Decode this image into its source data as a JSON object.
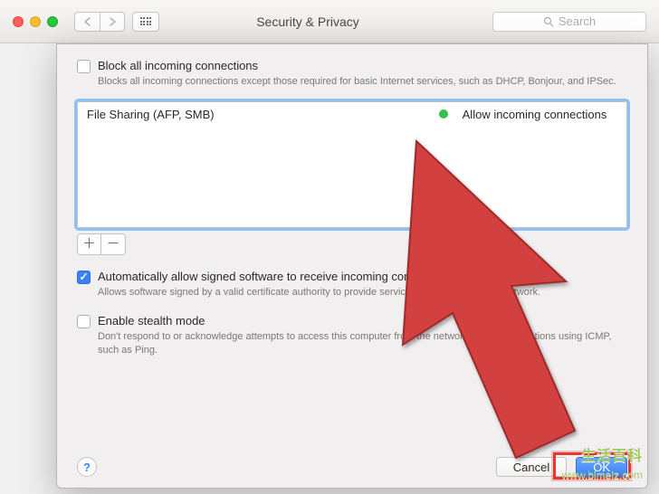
{
  "header": {
    "title": "Security & Privacy",
    "search_placeholder": "Search"
  },
  "block_all": {
    "checked": false,
    "label": "Block all incoming connections",
    "description": "Blocks all incoming connections except those required for basic Internet services, such as DHCP, Bonjour, and IPSec."
  },
  "list": {
    "items": [
      {
        "name": "File Sharing (AFP, SMB)",
        "status": "Allow incoming connections"
      }
    ]
  },
  "auto_allow": {
    "checked": true,
    "label": "Automatically allow signed software to receive incoming connections",
    "description": "Allows software signed by a valid certificate authority to provide services accessed from the network."
  },
  "stealth": {
    "checked": false,
    "label": "Enable stealth mode",
    "description": "Don't respond to or acknowledge attempts to access this computer from the network by test applications using ICMP, such as Ping."
  },
  "buttons": {
    "cancel": "Cancel",
    "ok": "OK",
    "help": "?"
  },
  "watermark": {
    "logo": "生活百科",
    "url": "www.bimeiz.com"
  }
}
